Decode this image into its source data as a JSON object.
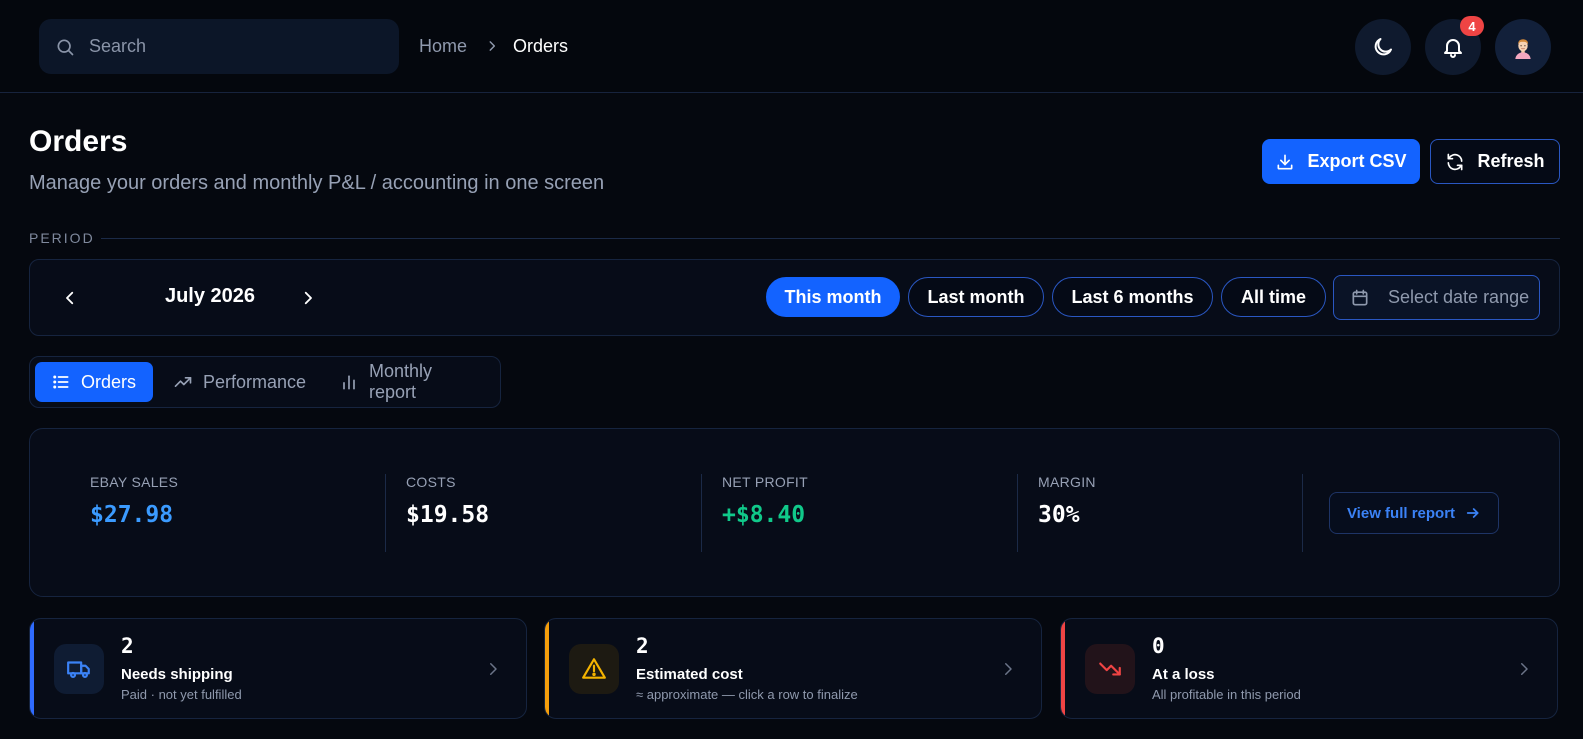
{
  "topbar": {
    "search_placeholder": "Search",
    "breadcrumb": {
      "home": "Home",
      "current": "Orders"
    },
    "notification_count": "4",
    "icons": [
      "search-icon",
      "chevron-right-icon",
      "moon-icon",
      "bell-icon",
      "avatar"
    ]
  },
  "header": {
    "title": "Orders",
    "subtitle": "Manage your orders and monthly P&L / accounting in one screen",
    "export_label": "Export CSV",
    "refresh_label": "Refresh"
  },
  "period": {
    "section_label": "PERIOD",
    "current_month": "July 2026",
    "presets": [
      "This month",
      "Last month",
      "Last 6 months",
      "All time"
    ],
    "active_preset": "This month",
    "date_range_placeholder": "Select date range"
  },
  "tabs": [
    {
      "label": "Orders",
      "icon": "list-icon",
      "active": true
    },
    {
      "label": "Performance",
      "icon": "trending-up-icon",
      "active": false
    },
    {
      "label": "Monthly report",
      "icon": "bar-chart-icon",
      "active": false
    }
  ],
  "summary": {
    "stats": [
      {
        "label": "EBAY SALES",
        "value": "$27.98",
        "color": "#3b9bff"
      },
      {
        "label": "COSTS",
        "value": "$19.58",
        "color": "#ffffff"
      },
      {
        "label": "NET PROFIT",
        "value": "+$8.40",
        "color": "#10c98a"
      },
      {
        "label": "MARGIN",
        "value": "30%",
        "color": "#ffffff"
      }
    ],
    "report_link": "View full report"
  },
  "alerts": [
    {
      "count": "2",
      "title": "Needs shipping",
      "subtitle": "Paid · not yet fulfilled",
      "accent": "#2f6bff",
      "icon": "truck-icon"
    },
    {
      "count": "2",
      "title": "Estimated cost",
      "subtitle": "≈ approximate — click a row to finalize",
      "accent": "#f59e0b",
      "icon": "warning-icon"
    },
    {
      "count": "0",
      "title": "At a loss",
      "subtitle": "All profitable in this period",
      "accent": "#ef4444",
      "icon": "trending-down-icon"
    }
  ],
  "colors": {
    "background": "#05080f",
    "primary": "#1363ff",
    "profit": "#10c98a",
    "sales": "#3b9bff",
    "loss": "#ef4444",
    "warning": "#f59e0b"
  }
}
